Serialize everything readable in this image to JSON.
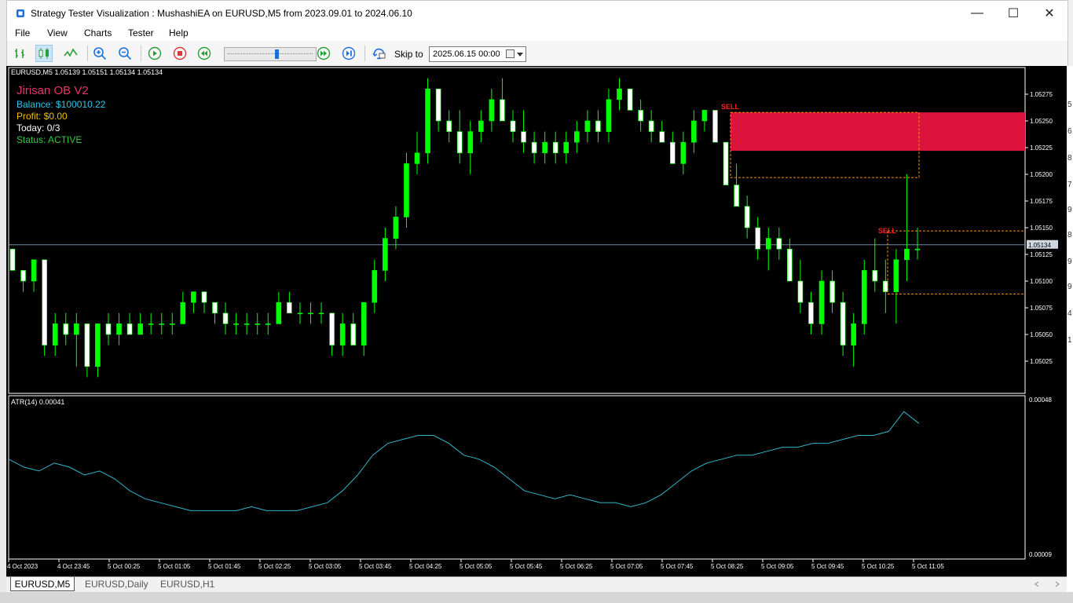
{
  "window": {
    "title": "Strategy Tester Visualization : MushashiEA on EURUSD,M5 from 2023.09.01 to 2024.06.10",
    "minimize": "—",
    "maximize": "☐",
    "close": "✕"
  },
  "menu": {
    "items": [
      "File",
      "View",
      "Charts",
      "Tester",
      "Help"
    ]
  },
  "toolbar": {
    "icons": [
      "bar-chart-icon",
      "candlestick-icon",
      "line-chart-icon",
      "zoom-in-icon",
      "zoom-out-icon",
      "play-icon",
      "stop-icon",
      "slower-icon",
      "faster-icon",
      "step-icon",
      "skip-to-icon",
      "calendar-icon"
    ],
    "skip_label": "Skip to",
    "skip_value": "2025.06.15 00:00"
  },
  "colors": {
    "bull": "#00ff00",
    "bear": "#ffffff",
    "zone": "#dc143c",
    "atr": "#33b5c8",
    "sell": "#ff2020",
    "dash": "#ff8c00"
  },
  "chart": {
    "header": "EURUSD,M5  1.05139 1.05151 1.05134 1.05134",
    "price_labels": [
      "1.05275",
      "1.05250",
      "1.05225",
      "1.05200",
      "1.05175",
      "1.05150",
      "1.05125",
      "1.05100",
      "1.05075",
      "1.05050",
      "1.05025"
    ],
    "current_price": "1.05134",
    "sell_label": "SELL",
    "time_labels": [
      "4 Oct 2023",
      "4 Oct 23:45",
      "5 Oct 00:25",
      "5 Oct 01:05",
      "5 Oct 01:45",
      "5 Oct 02:25",
      "5 Oct 03:05",
      "5 Oct 03:45",
      "5 Oct 04:25",
      "5 Oct 05:05",
      "5 Oct 05:45",
      "5 Oct 06:25",
      "5 Oct 07:05",
      "5 Oct 07:45",
      "5 Oct 08:25",
      "5 Oct 09:05",
      "5 Oct 09:45",
      "5 Oct 10:25",
      "5 Oct 11:05"
    ]
  },
  "panel": {
    "name": "Jirisan OB V2",
    "balance": "Balance: $100010.22",
    "profit": "Profit: $0.00",
    "today": "Today: 0/3",
    "status": "Status: ACTIVE"
  },
  "atr": {
    "label": "ATR(14) 0.00041",
    "max_label": "0.00048",
    "min_label": "0.00009"
  },
  "tabs": [
    "EURUSD,M5",
    "EURUSD,Daily",
    "EURUSD,H1"
  ],
  "chart_data": {
    "type": "candlestick",
    "symbol": "EURUSD",
    "timeframe": "M5",
    "ylim": [
      1.05005,
      1.05295
    ],
    "ohlc": [
      [
        1.0513,
        1.0513,
        1.0511,
        1.0511
      ],
      [
        1.0511,
        1.0511,
        1.0509,
        1.051
      ],
      [
        1.051,
        1.0512,
        1.0509,
        1.0512
      ],
      [
        1.0512,
        1.0512,
        1.0503,
        1.0504
      ],
      [
        1.0504,
        1.0507,
        1.0503,
        1.0506
      ],
      [
        1.0506,
        1.0507,
        1.0504,
        1.0505
      ],
      [
        1.0505,
        1.0507,
        1.0502,
        1.0506
      ],
      [
        1.0506,
        1.0506,
        1.0501,
        1.0502
      ],
      [
        1.0502,
        1.0506,
        1.0501,
        1.0506
      ],
      [
        1.0506,
        1.0507,
        1.0504,
        1.0505
      ],
      [
        1.0505,
        1.0507,
        1.0504,
        1.0506
      ],
      [
        1.0506,
        1.0507,
        1.0505,
        1.0505
      ],
      [
        1.0505,
        1.0507,
        1.0505,
        1.0506
      ],
      [
        1.0506,
        1.0507,
        1.0505,
        1.0506
      ],
      [
        1.0506,
        1.0507,
        1.0505,
        1.0506
      ],
      [
        1.0506,
        1.0507,
        1.0505,
        1.0506
      ],
      [
        1.0506,
        1.0509,
        1.0506,
        1.0508
      ],
      [
        1.0508,
        1.0509,
        1.0507,
        1.0509
      ],
      [
        1.0509,
        1.0509,
        1.0507,
        1.0508
      ],
      [
        1.0508,
        1.0508,
        1.0506,
        1.0507
      ],
      [
        1.0507,
        1.0508,
        1.0505,
        1.0506
      ],
      [
        1.0506,
        1.0507,
        1.0505,
        1.0506
      ],
      [
        1.0506,
        1.0507,
        1.0505,
        1.0506
      ],
      [
        1.0506,
        1.0507,
        1.0505,
        1.0506
      ],
      [
        1.0506,
        1.0507,
        1.0505,
        1.0506
      ],
      [
        1.0506,
        1.0509,
        1.0506,
        1.0508
      ],
      [
        1.0508,
        1.0509,
        1.0507,
        1.0507
      ],
      [
        1.0507,
        1.0508,
        1.0506,
        1.0507
      ],
      [
        1.0507,
        1.0508,
        1.0506,
        1.0507
      ],
      [
        1.0507,
        1.0508,
        1.0506,
        1.0507
      ],
      [
        1.0507,
        1.0507,
        1.0503,
        1.0504
      ],
      [
        1.0504,
        1.0507,
        1.0503,
        1.0506
      ],
      [
        1.0506,
        1.0507,
        1.0504,
        1.0504
      ],
      [
        1.0504,
        1.0508,
        1.0503,
        1.0508
      ],
      [
        1.0508,
        1.0512,
        1.0507,
        1.0511
      ],
      [
        1.0511,
        1.0515,
        1.051,
        1.0514
      ],
      [
        1.0514,
        1.0517,
        1.0513,
        1.0516
      ],
      [
        1.0516,
        1.0522,
        1.0515,
        1.0521
      ],
      [
        1.0521,
        1.0524,
        1.052,
        1.0522
      ],
      [
        1.0522,
        1.0529,
        1.0521,
        1.0528
      ],
      [
        1.0528,
        1.0528,
        1.0524,
        1.0525
      ],
      [
        1.0525,
        1.0526,
        1.0523,
        1.0524
      ],
      [
        1.0524,
        1.0526,
        1.0521,
        1.0522
      ],
      [
        1.0522,
        1.0525,
        1.052,
        1.0524
      ],
      [
        1.0524,
        1.0526,
        1.0523,
        1.0525
      ],
      [
        1.0525,
        1.0528,
        1.0524,
        1.0527
      ],
      [
        1.0527,
        1.0529,
        1.0525,
        1.0525
      ],
      [
        1.0525,
        1.0526,
        1.0523,
        1.0524
      ],
      [
        1.0524,
        1.0526,
        1.0522,
        1.0523
      ],
      [
        1.0523,
        1.0524,
        1.0521,
        1.0522
      ],
      [
        1.0522,
        1.0524,
        1.0521,
        1.0523
      ],
      [
        1.0523,
        1.0524,
        1.0521,
        1.0522
      ],
      [
        1.0522,
        1.0524,
        1.0521,
        1.0523
      ],
      [
        1.0523,
        1.0525,
        1.0522,
        1.0524
      ],
      [
        1.0524,
        1.0526,
        1.0523,
        1.0525
      ],
      [
        1.0525,
        1.0526,
        1.0523,
        1.0524
      ],
      [
        1.0524,
        1.0528,
        1.0523,
        1.0527
      ],
      [
        1.0527,
        1.0529,
        1.0526,
        1.0528
      ],
      [
        1.0528,
        1.0528,
        1.0526,
        1.0526
      ],
      [
        1.0526,
        1.0527,
        1.0524,
        1.0525
      ],
      [
        1.0525,
        1.0526,
        1.0523,
        1.0524
      ],
      [
        1.0524,
        1.0525,
        1.0523,
        1.0523
      ],
      [
        1.0523,
        1.0524,
        1.0521,
        1.0521
      ],
      [
        1.0521,
        1.0524,
        1.052,
        1.0523
      ],
      [
        1.0523,
        1.0526,
        1.0522,
        1.0525
      ],
      [
        1.0525,
        1.0526,
        1.0524,
        1.0526
      ],
      [
        1.0526,
        1.0526,
        1.0523,
        1.0523
      ],
      [
        1.0523,
        1.0523,
        1.0519,
        1.0519
      ],
      [
        1.0519,
        1.0521,
        1.0517,
        1.0517
      ],
      [
        1.0517,
        1.0518,
        1.0514,
        1.0515
      ],
      [
        1.0515,
        1.0516,
        1.0512,
        1.0513
      ],
      [
        1.0513,
        1.0515,
        1.0511,
        1.0514
      ],
      [
        1.0514,
        1.0515,
        1.0512,
        1.0513
      ],
      [
        1.0513,
        1.0514,
        1.051,
        1.051
      ],
      [
        1.051,
        1.0512,
        1.0507,
        1.0508
      ],
      [
        1.0508,
        1.0509,
        1.0505,
        1.0506
      ],
      [
        1.0506,
        1.0511,
        1.0505,
        1.051
      ],
      [
        1.051,
        1.0511,
        1.0507,
        1.0508
      ],
      [
        1.0508,
        1.0509,
        1.0503,
        1.0504
      ],
      [
        1.0504,
        1.0507,
        1.0502,
        1.0506
      ],
      [
        1.0506,
        1.0512,
        1.0505,
        1.0511
      ],
      [
        1.0511,
        1.0514,
        1.0509,
        1.051
      ],
      [
        1.051,
        1.0512,
        1.0507,
        1.0509
      ],
      [
        1.0509,
        1.0513,
        1.0506,
        1.0512
      ],
      [
        1.0512,
        1.052,
        1.051,
        1.0513
      ],
      [
        1.0513,
        1.0515,
        1.0512,
        1.0513
      ]
    ],
    "sell_zone": {
      "high": 1.05258,
      "low": 1.05222,
      "outline_low": 1.05197
    },
    "sell_level_top": 1.05147,
    "sell_level_bottom": 1.05088,
    "atr": [
      0.00033,
      0.00031,
      0.0003,
      0.00032,
      0.00031,
      0.00029,
      0.0003,
      0.00028,
      0.00025,
      0.00023,
      0.00022,
      0.00021,
      0.0002,
      0.0002,
      0.0002,
      0.0002,
      0.00021,
      0.0002,
      0.0002,
      0.0002,
      0.00021,
      0.00022,
      0.00025,
      0.00029,
      0.00034,
      0.00037,
      0.00038,
      0.00039,
      0.00039,
      0.00037,
      0.00034,
      0.00033,
      0.00031,
      0.00028,
      0.00025,
      0.00024,
      0.00023,
      0.00024,
      0.00023,
      0.00022,
      0.00022,
      0.00021,
      0.00022,
      0.00024,
      0.00027,
      0.0003,
      0.00032,
      0.00033,
      0.00034,
      0.00034,
      0.00035,
      0.00036,
      0.00036,
      0.00037,
      0.00037,
      0.00038,
      0.00039,
      0.00039,
      0.0004,
      0.00045,
      0.00042
    ]
  }
}
